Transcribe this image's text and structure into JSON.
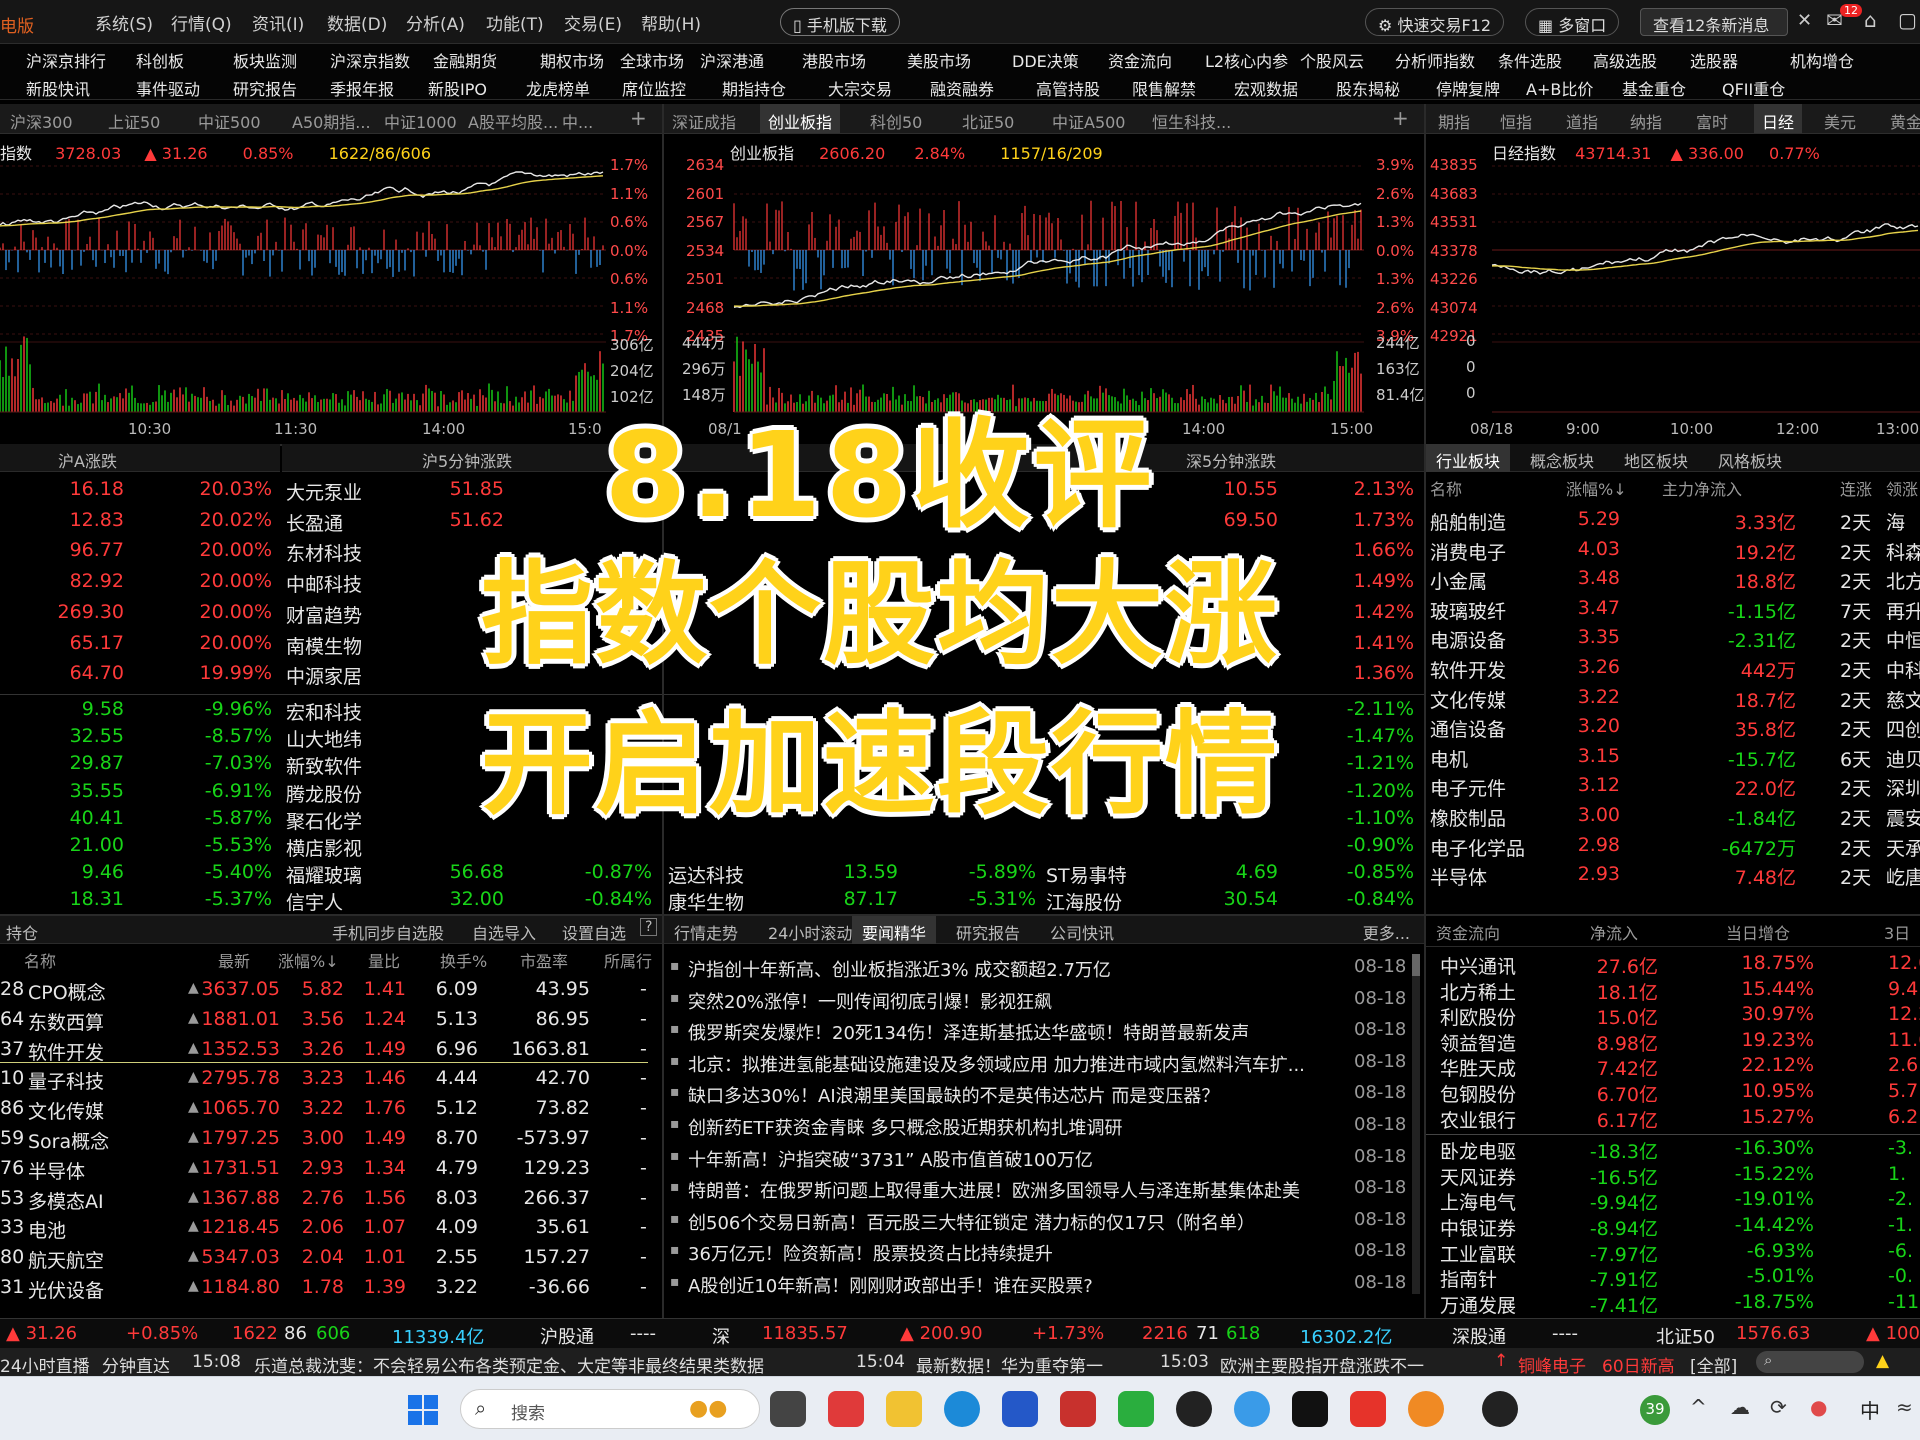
{
  "titlebar": {
    "logo": "电版",
    "menus": [
      "系统(S)",
      "行情(Q)",
      "资讯(I)",
      "数据(D)",
      "分析(A)",
      "功能(T)",
      "交易(E)",
      "帮助(H)"
    ],
    "mobile": "手机版下载",
    "fast_trade": "快速交易F12",
    "multi_window": "多窗口",
    "messages": "查看12条新消息",
    "msg_badge": "12"
  },
  "menu1": [
    "沪深京排行",
    "科创板",
    "板块监测",
    "沪深京指数",
    "金融期货",
    "期权市场",
    "全球市场",
    "沪深港通",
    "港股市场",
    "美股市场",
    "DDE决策",
    "资金流向",
    "L2核心内参",
    "个股风云",
    "分析师指数",
    "条件选股",
    "高级选股",
    "选股器",
    "机构增仓"
  ],
  "menu2": [
    "新股快讯",
    "事件驱动",
    "研究报告",
    "季报年报",
    "新股IPO",
    "龙虎榜单",
    "席位监控",
    "期指持仓",
    "大宗交易",
    "融资融券",
    "高管持股",
    "限售解禁",
    "宏观数据",
    "股东揭秘",
    "停牌复牌",
    "A+B比价",
    "基金重仓",
    "QFII重仓"
  ],
  "panel1": {
    "tabs": [
      "沪深300",
      "上证50",
      "中证500",
      "A50期指...",
      "中证1000",
      "A股平均股...",
      "中..."
    ],
    "index_name": "指数",
    "price": "3728.03",
    "change": "▲ 31.26",
    "pct": "0.85%",
    "breadth": "1622/86/606",
    "pct_axis": [
      "1.7%",
      "1.1%",
      "0.6%",
      "0.0%",
      "0.6%",
      "1.1%",
      "1.7%"
    ],
    "vol_axis": [
      "306亿",
      "204亿",
      "102亿"
    ],
    "time_axis": [
      "10:30",
      "11:30",
      "14:00",
      "15:0"
    ]
  },
  "panel2": {
    "tabs": [
      "深证成指",
      "创业板指",
      "科创50",
      "北证50",
      "中证A500",
      "恒生科技..."
    ],
    "index_name": "创业板指",
    "price": "2606.20",
    "pct": "2.84%",
    "breadth": "1157/16/209",
    "price_axis": [
      "2634",
      "2601",
      "2567",
      "2534",
      "2501",
      "2468",
      "2435"
    ],
    "pct_axis": [
      "3.9%",
      "2.6%",
      "1.3%",
      "0.0%",
      "1.3%",
      "2.6%",
      "3.9%"
    ],
    "vol_left": [
      "444万",
      "296万",
      "148万"
    ],
    "vol_axis": [
      "244亿",
      "163亿",
      "81.4亿"
    ],
    "time_axis": [
      "08/1",
      "14:00",
      "15:00"
    ]
  },
  "panel3": {
    "tabs": [
      "期指",
      "恒指",
      "道指",
      "纳指",
      "富时",
      "日经",
      "美元",
      "黄金"
    ],
    "index_name": "日经指数",
    "price": "43714.31",
    "change": "▲ 336.00",
    "pct": "0.77%",
    "price_axis": [
      "43835",
      "43683",
      "43531",
      "43378",
      "43226",
      "43074",
      "42921"
    ],
    "vol_axis": [
      "0",
      "0",
      "0"
    ],
    "time_axis": [
      "08/18",
      "9:00",
      "10:00",
      "12:00",
      "13:00"
    ]
  },
  "sh_list": {
    "header_a": "沪A涨跌",
    "header_b": "沪5分钟涨跌",
    "rows": [
      {
        "p": "16.18",
        "pct": "20.03%",
        "name": "大元泵业",
        "v": "51.85"
      },
      {
        "p": "12.83",
        "pct": "20.02%",
        "name": "长盈通",
        "v": "51.62"
      },
      {
        "p": "96.77",
        "pct": "20.00%",
        "name": "东材科技",
        "v": ""
      },
      {
        "p": "82.92",
        "pct": "20.00%",
        "name": "中邮科技",
        "v": ""
      },
      {
        "p": "269.30",
        "pct": "20.00%",
        "name": "财富趋势",
        "v": ""
      },
      {
        "p": "65.17",
        "pct": "20.00%",
        "name": "南模生物",
        "v": ""
      },
      {
        "p": "64.70",
        "pct": "19.99%",
        "name": "中源家居",
        "v": ""
      },
      {
        "p": "9.58",
        "pct": "-9.96%",
        "name": "宏和科技",
        "v": ""
      },
      {
        "p": "32.55",
        "pct": "-8.57%",
        "name": "山大地纬",
        "v": ""
      },
      {
        "p": "29.87",
        "pct": "-7.03%",
        "name": "新致软件",
        "v": ""
      },
      {
        "p": "35.55",
        "pct": "-6.91%",
        "name": "腾龙股份",
        "v": ""
      },
      {
        "p": "40.41",
        "pct": "-5.87%",
        "name": "聚石化学",
        "v": ""
      },
      {
        "p": "21.00",
        "pct": "-5.53%",
        "name": "横店影视",
        "v": ""
      },
      {
        "p": "9.46",
        "pct": "-5.40%",
        "name": "福耀玻璃",
        "v": "56.68",
        "v2": "-0.87%"
      },
      {
        "p": "18.31",
        "pct": "-5.37%",
        "name": "信宇人",
        "v": "32.00",
        "v2": "-0.84%"
      }
    ]
  },
  "sz_list": {
    "header": "深5分钟涨跌",
    "rows": [
      {
        "p": "10.55",
        "pct": "2.13%"
      },
      {
        "p": "69.50",
        "pct": "1.73%"
      },
      {
        "p": "",
        "pct": "1.66%"
      },
      {
        "p": "",
        "pct": "1.49%"
      },
      {
        "p": "",
        "pct": "1.42%"
      },
      {
        "p": "",
        "pct": "1.41%"
      },
      {
        "p": "",
        "pct": "1.36%"
      },
      {
        "p": "",
        "pct": "-2.11%"
      },
      {
        "p": "",
        "pct": "-1.47%"
      },
      {
        "p": "",
        "pct": "-1.21%"
      },
      {
        "p": "",
        "pct": "-1.20%"
      },
      {
        "p": "",
        "pct": "-1.10%"
      },
      {
        "p": "",
        "pct": "-0.90%"
      },
      {
        "name": "ST易事特",
        "p": "4.69",
        "pct": "-0.85%"
      },
      {
        "name": "江海股份",
        "p": "30.54",
        "pct": "-0.84%"
      }
    ],
    "extra": [
      {
        "name": "运达科技",
        "p": "13.59",
        "pct": "-5.89%"
      },
      {
        "name": "康华生物",
        "p": "87.17",
        "pct": "-5.31%"
      }
    ]
  },
  "sector": {
    "tabs": [
      "行业板块",
      "概念板块",
      "地区板块",
      "风格板块"
    ],
    "cols": [
      "名称",
      "涨幅%↓",
      "主力净流入",
      "连涨",
      "领涨"
    ],
    "rows": [
      {
        "n": "船舶制造",
        "pct": "5.29",
        "flow": "3.33亿",
        "d": "2天",
        "l": "海"
      },
      {
        "n": "消费电子",
        "pct": "4.03",
        "flow": "19.2亿",
        "d": "2天",
        "l": "科森"
      },
      {
        "n": "小金属",
        "pct": "3.48",
        "flow": "18.8亿",
        "d": "2天",
        "l": "北方"
      },
      {
        "n": "玻璃玻纤",
        "pct": "3.47",
        "flow": "-1.15亿",
        "d": "7天",
        "l": "再升"
      },
      {
        "n": "电源设备",
        "pct": "3.35",
        "flow": "-2.31亿",
        "d": "2天",
        "l": "中恒"
      },
      {
        "n": "软件开发",
        "pct": "3.26",
        "flow": "442万",
        "d": "2天",
        "l": "中科"
      },
      {
        "n": "文化传媒",
        "pct": "3.22",
        "flow": "18.7亿",
        "d": "2天",
        "l": "慈文"
      },
      {
        "n": "通信设备",
        "pct": "3.20",
        "flow": "35.8亿",
        "d": "2天",
        "l": "四创"
      },
      {
        "n": "电机",
        "pct": "3.15",
        "flow": "-15.7亿",
        "d": "6天",
        "l": "迪贝"
      },
      {
        "n": "电子元件",
        "pct": "3.12",
        "flow": "22.0亿",
        "d": "2天",
        "l": "深圳"
      },
      {
        "n": "橡胶制品",
        "pct": "3.00",
        "flow": "-1.84亿",
        "d": "2天",
        "l": "震安"
      },
      {
        "n": "电子化学品",
        "pct": "2.98",
        "flow": "-6472万",
        "d": "2天",
        "l": "天承"
      },
      {
        "n": "半导体",
        "pct": "2.93",
        "flow": "7.48亿",
        "d": "2天",
        "l": "屹唐"
      }
    ]
  },
  "watch": {
    "tabs": [
      "持仓",
      "手机同步自选股",
      "自选导入",
      "设置自选"
    ],
    "cols": [
      "名称",
      "最新",
      "涨幅%↓",
      "量比",
      "换手%",
      "市盈率",
      "所属行"
    ],
    "rows": [
      {
        "no": "28",
        "n": "CPO概念",
        "p": "3637.05",
        "pct": "5.82",
        "lb": "1.41",
        "hs": "6.09",
        "pe": "43.95"
      },
      {
        "no": "64",
        "n": "东数西算",
        "p": "1881.01",
        "pct": "3.56",
        "lb": "1.24",
        "hs": "5.13",
        "pe": "86.95"
      },
      {
        "no": "37",
        "n": "软件开发",
        "p": "1352.53",
        "pct": "3.26",
        "lb": "1.49",
        "hs": "6.96",
        "pe": "1663.81"
      },
      {
        "no": "10",
        "n": "量子科技",
        "p": "2795.78",
        "pct": "3.23",
        "lb": "1.46",
        "hs": "4.44",
        "pe": "42.70"
      },
      {
        "no": "86",
        "n": "文化传媒",
        "p": "1065.70",
        "pct": "3.22",
        "lb": "1.76",
        "hs": "5.12",
        "pe": "73.82"
      },
      {
        "no": "59",
        "n": "Sora概念",
        "p": "1797.25",
        "pct": "3.00",
        "lb": "1.49",
        "hs": "8.70",
        "pe": "-573.97"
      },
      {
        "no": "76",
        "n": "半导体",
        "p": "1731.51",
        "pct": "2.93",
        "lb": "1.34",
        "hs": "4.79",
        "pe": "129.23"
      },
      {
        "no": "53",
        "n": "多模态AI",
        "p": "1367.88",
        "pct": "2.76",
        "lb": "1.56",
        "hs": "8.03",
        "pe": "266.37"
      },
      {
        "no": "33",
        "n": "电池",
        "p": "1218.45",
        "pct": "2.06",
        "lb": "1.07",
        "hs": "4.09",
        "pe": "35.61"
      },
      {
        "no": "80",
        "n": "航天航空",
        "p": "5347.03",
        "pct": "2.04",
        "lb": "1.01",
        "hs": "2.55",
        "pe": "157.27"
      },
      {
        "no": "31",
        "n": "光伏设备",
        "p": "1184.80",
        "pct": "1.78",
        "lb": "1.39",
        "hs": "3.22",
        "pe": "-36.66"
      }
    ]
  },
  "news": {
    "tabs": [
      "行情走势",
      "24小时滚动",
      "要闻精华",
      "研究报告",
      "公司快讯"
    ],
    "more": "更多...",
    "rows": [
      {
        "t": "沪指创十年新高、创业板指涨近3% 成交额超2.7万亿",
        "d": "08-18"
      },
      {
        "t": "突然20%涨停！一则传闻彻底引爆！影视狂飙",
        "d": "08-18"
      },
      {
        "t": "俄罗斯突发爆炸！20死134伤！泽连斯基抵达华盛顿！特朗普最新发声",
        "d": "08-18"
      },
      {
        "t": "北京：拟推进氢能基础设施建设及多领域应用 加力推进市域内氢燃料汽车扩...",
        "d": "08-18"
      },
      {
        "t": "缺口多达30%！AI浪潮里美国最缺的不是英伟达芯片 而是变压器？",
        "d": "08-18"
      },
      {
        "t": "创新药ETF获资金青睐 多只概念股近期获机构扎堆调研",
        "d": "08-18"
      },
      {
        "t": "十年新高！沪指突破“3731” A股市值首破100万亿",
        "d": "08-18"
      },
      {
        "t": "特朗普：在俄罗斯问题上取得重大进展！欧洲多国领导人与泽连斯基集体赴美",
        "d": "08-18"
      },
      {
        "t": "创506个交易日新高！百元股三大特征锁定 潜力标的仅17只（附名单）",
        "d": "08-18"
      },
      {
        "t": "36万亿元！险资新高！股票投资占比持续提升",
        "d": "08-18"
      },
      {
        "t": "A股创近10年新高！刚刚财政部出手！谁在买股票?",
        "d": "08-18"
      }
    ]
  },
  "flow": {
    "cols": [
      "资金流向",
      "净流入",
      "当日增仓",
      "3日"
    ],
    "rows": [
      {
        "n": "中兴通讯",
        "v": "27.6亿",
        "z": "18.75%",
        "d": "12.0"
      },
      {
        "n": "北方稀土",
        "v": "18.1亿",
        "z": "15.44%",
        "d": "9.4"
      },
      {
        "n": "利欧股份",
        "v": "15.0亿",
        "z": "30.97%",
        "d": "12.2"
      },
      {
        "n": "领益智造",
        "v": "8.98亿",
        "z": "19.23%",
        "d": "11.6"
      },
      {
        "n": "华胜天成",
        "v": "7.42亿",
        "z": "22.12%",
        "d": "2.6"
      },
      {
        "n": "包钢股份",
        "v": "6.70亿",
        "z": "10.95%",
        "d": "5.7"
      },
      {
        "n": "农业银行",
        "v": "6.17亿",
        "z": "15.27%",
        "d": "6.2"
      },
      {
        "n": "卧龙电驱",
        "v": "-18.3亿",
        "z": "-16.30%",
        "d": "-3."
      },
      {
        "n": "天风证券",
        "v": "-16.5亿",
        "z": "-15.22%",
        "d": "1."
      },
      {
        "n": "上海电气",
        "v": "-9.94亿",
        "z": "-19.01%",
        "d": "-2."
      },
      {
        "n": "中银证券",
        "v": "-8.94亿",
        "z": "-14.42%",
        "d": "-1."
      },
      {
        "n": "工业富联",
        "v": "-7.97亿",
        "z": "-6.93%",
        "d": "-6."
      },
      {
        "n": "指南针",
        "v": "-7.91亿",
        "z": "-5.01%",
        "d": "-0."
      },
      {
        "n": "万通发展",
        "v": "-7.41亿",
        "z": "-18.75%",
        "d": "-11."
      }
    ]
  },
  "status": {
    "sh_chg": "▲ 31.26",
    "sh_pct": "+0.85%",
    "sh_up": "1622",
    "sh_flat": "86",
    "sh_dn": "606",
    "sh_amt": "11339.4亿",
    "hgt": "沪股通",
    "hgt_v": "----",
    "sz_label": "深",
    "sz": "11835.57",
    "sz_chg": "▲ 200.90",
    "sz_pct": "+1.73%",
    "sz_up": "2216",
    "sz_flat": "71",
    "sz_dn": "618",
    "sz_amt": "16302.2亿",
    "sgt": "深股通",
    "sgt_v": "----",
    "bz": "北证50",
    "bz_v": "1576.63",
    "bz_chg": "▲ 100"
  },
  "ticker": {
    "a": "24小时直播",
    "b": "分钟直达",
    "t1": "15:08",
    "n1": "乐道总裁沈斐：不会轻易公布各类预定金、大定等非最终结果类数据",
    "t2": "15:04",
    "n2": "最新数据！华为重夺第一",
    "t3": "15:03",
    "n3": "欧洲主要股指开盘涨跌不一",
    "hot": "铜峰电子",
    "hot2": "60日新高",
    "all": "[全部]"
  },
  "overlay": {
    "line1": "8.18收评",
    "line2": "指数个股均大涨",
    "line3": "开启加速段行情"
  },
  "taskbar": {
    "search": "搜索",
    "weather": "39",
    "ime": "中"
  },
  "colors": {
    "up": "#ff3a3a",
    "down": "#18d418",
    "title": "#ffd21a"
  }
}
